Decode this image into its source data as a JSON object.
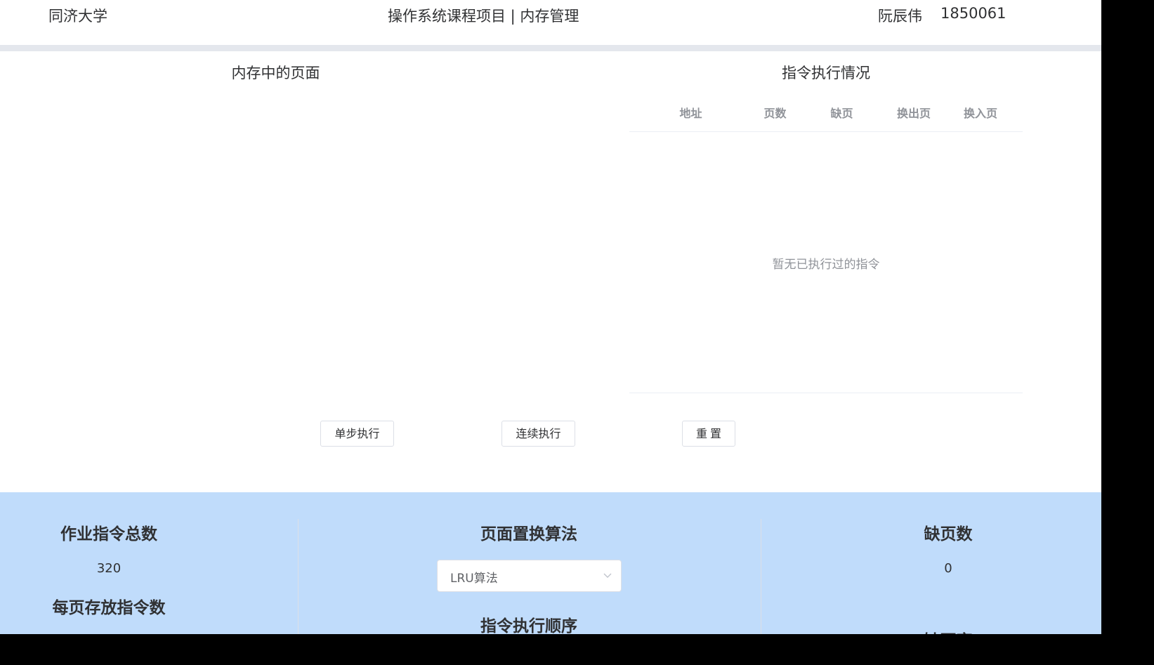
{
  "header": {
    "school": "同济大学",
    "title": "操作系统课程项目 | 内存管理",
    "author": "阮辰伟",
    "student_id": "1850061"
  },
  "memory_panel": {
    "title": "内存中的页面"
  },
  "instruction_panel": {
    "title": "指令执行情况",
    "columns": [
      "地址",
      "页数",
      "缺页",
      "换出页",
      "换入页"
    ],
    "empty_text": "暂无已执行过的指令"
  },
  "controls": {
    "step_label": "单步执行",
    "continuous_label": "连续执行",
    "reset_label": "重置"
  },
  "stats": {
    "total_instructions_label": "作业指令总数",
    "total_instructions_value": "320",
    "per_page_label": "每页存放指令数",
    "algorithm_label": "页面置换算法",
    "algorithm_selected": "LRU算法",
    "execution_order_label": "指令执行顺序",
    "page_faults_label": "缺页数",
    "page_faults_value": "0",
    "page_fault_rate_label": "缺页率"
  },
  "colors": {
    "bottom_panel": "#c0dcfb",
    "header_divider": "#e4e7ed",
    "text": "#303133",
    "muted_text": "#909399"
  }
}
